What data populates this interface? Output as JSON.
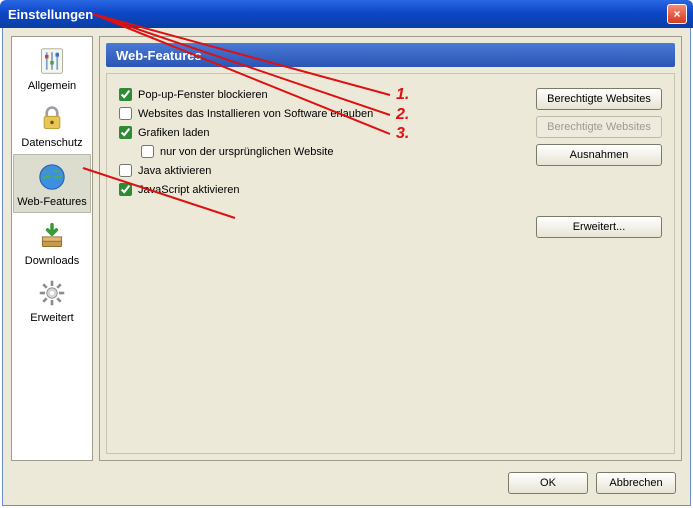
{
  "window": {
    "title": "Einstellungen",
    "close_symbol": "×"
  },
  "sidebar": {
    "items": [
      {
        "id": "allgemein",
        "label": "Allgemein",
        "icon": "sliders-icon",
        "selected": false
      },
      {
        "id": "datenschutz",
        "label": "Datenschutz",
        "icon": "lock-icon",
        "selected": false
      },
      {
        "id": "webfeatures",
        "label": "Web-Features",
        "icon": "globe-icon",
        "selected": true
      },
      {
        "id": "downloads",
        "label": "Downloads",
        "icon": "download-icon",
        "selected": false
      },
      {
        "id": "erweitert",
        "label": "Erweitert",
        "icon": "gear-icon",
        "selected": false
      }
    ]
  },
  "panel": {
    "title": "Web-Features",
    "options": {
      "popup": {
        "label": "Pop-up-Fenster blockieren",
        "checked": true
      },
      "install": {
        "label": "Websites das Installieren von Software erlauben",
        "checked": false
      },
      "images": {
        "label": "Grafiken laden",
        "checked": true
      },
      "images_only": {
        "label": "nur von der ursprünglichen Website",
        "checked": false
      },
      "java": {
        "label": "Java aktivieren",
        "checked": false
      },
      "javascript": {
        "label": "JavaScript aktivieren",
        "checked": true
      }
    },
    "buttons": {
      "allowed_popup": "Berechtigte Websites",
      "allowed_install": "Berechtigte Websites",
      "exceptions": "Ausnahmen",
      "advanced": "Erweitert..."
    }
  },
  "footer": {
    "ok": "OK",
    "cancel": "Abbrechen"
  },
  "annotations": {
    "n1": "1.",
    "n2": "2.",
    "n3": "3."
  }
}
